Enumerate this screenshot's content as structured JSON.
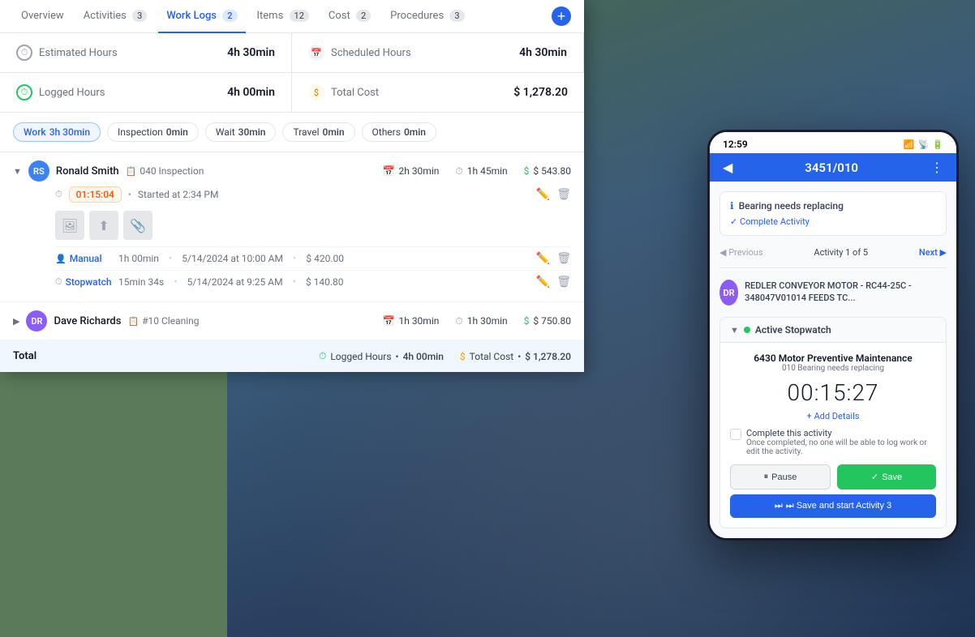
{
  "tabs": {
    "items": [
      {
        "id": "overview",
        "label": "Overview",
        "badge": null,
        "active": false
      },
      {
        "id": "activities",
        "label": "Activities",
        "badge": "3",
        "active": false
      },
      {
        "id": "worklogs",
        "label": "Work Logs",
        "badge": "2",
        "active": true
      },
      {
        "id": "items",
        "label": "Items",
        "badge": "12",
        "active": false
      },
      {
        "id": "cost",
        "label": "Cost",
        "badge": "2",
        "active": false
      },
      {
        "id": "procedures",
        "label": "Procedures",
        "badge": "3",
        "active": false
      }
    ],
    "add_label": "+"
  },
  "stats": {
    "estimated_hours_label": "Estimated Hours",
    "estimated_hours_value": "4h 30min",
    "scheduled_hours_label": "Scheduled Hours",
    "scheduled_hours_value": "4h 30min",
    "logged_hours_label": "Logged Hours",
    "logged_hours_value": "4h 00min",
    "total_cost_label": "Total Cost",
    "total_cost_value": "$ 1,278.20"
  },
  "filters": [
    {
      "id": "work",
      "label": "Work",
      "count": "3h 30min",
      "active": true
    },
    {
      "id": "inspection",
      "label": "Inspection",
      "count": "0min",
      "active": false
    },
    {
      "id": "wait",
      "label": "Wait",
      "count": "30min",
      "active": false
    },
    {
      "id": "travel",
      "label": "Travel",
      "count": "0min",
      "active": false
    },
    {
      "id": "others",
      "label": "Others",
      "count": "0min",
      "active": false
    }
  ],
  "workers": [
    {
      "id": "ronald",
      "name": "Ronald Smith",
      "tag_icon": "📋",
      "tag": "040 Inspection",
      "scheduled": "2h 30min",
      "logged": "1h 45min",
      "cost": "$ 543.80",
      "expanded": true,
      "timer": {
        "time": "01:15:04",
        "started": "Started at 2:34 PM"
      },
      "logs": [
        {
          "type": "Manual",
          "duration": "1h 00min",
          "date": "5/14/2024 at 10:00 AM",
          "cost": "$ 420.00"
        },
        {
          "type": "Stopwatch",
          "duration": "15min 34s",
          "date": "5/14/2024 at 9:25 AM",
          "cost": "$ 140.80"
        }
      ]
    },
    {
      "id": "dave",
      "name": "Dave Richards",
      "tag_icon": "📋",
      "tag": "#10 Cleaning",
      "scheduled": "1h 30min",
      "logged": "1h 30min",
      "cost": "$ 750.80",
      "expanded": false,
      "timer": null,
      "logs": []
    }
  ],
  "total": {
    "label": "Total",
    "logged_hours_label": "Logged Hours",
    "logged_hours_value": "4h 00min",
    "total_cost_label": "Total Cost",
    "total_cost_value": "$ 1,278.20"
  },
  "phone": {
    "status_time": "12:59",
    "header_title": "3451/010",
    "alert_icon": "ℹ",
    "alert_title": "Bearing needs replacing",
    "alert_action": "✓ Complete Activity",
    "nav_prev": "◀ Previous",
    "nav_current": "Activity 1 of 5",
    "nav_next": "Next ▶",
    "conveyor_title": "REDLER CONVEYOR MOTOR - RC44-25C - 348047V01014 FEEDS TC...",
    "stopwatch_section_label": "Active Stopwatch",
    "wo_title": "6430 Motor Preventive Maintenance",
    "wo_sub": "010 Bearing needs replacing",
    "timer_display": "00:15:27",
    "add_details": "+ Add Details",
    "complete_title": "Complete this activity",
    "complete_sub": "Once completed, no one will be able to log work or edit the activity.",
    "btn_pause": "⏸ Pause",
    "btn_save": "✓ Save",
    "btn_save_activity": "⏭ Save and start Activity 3"
  }
}
